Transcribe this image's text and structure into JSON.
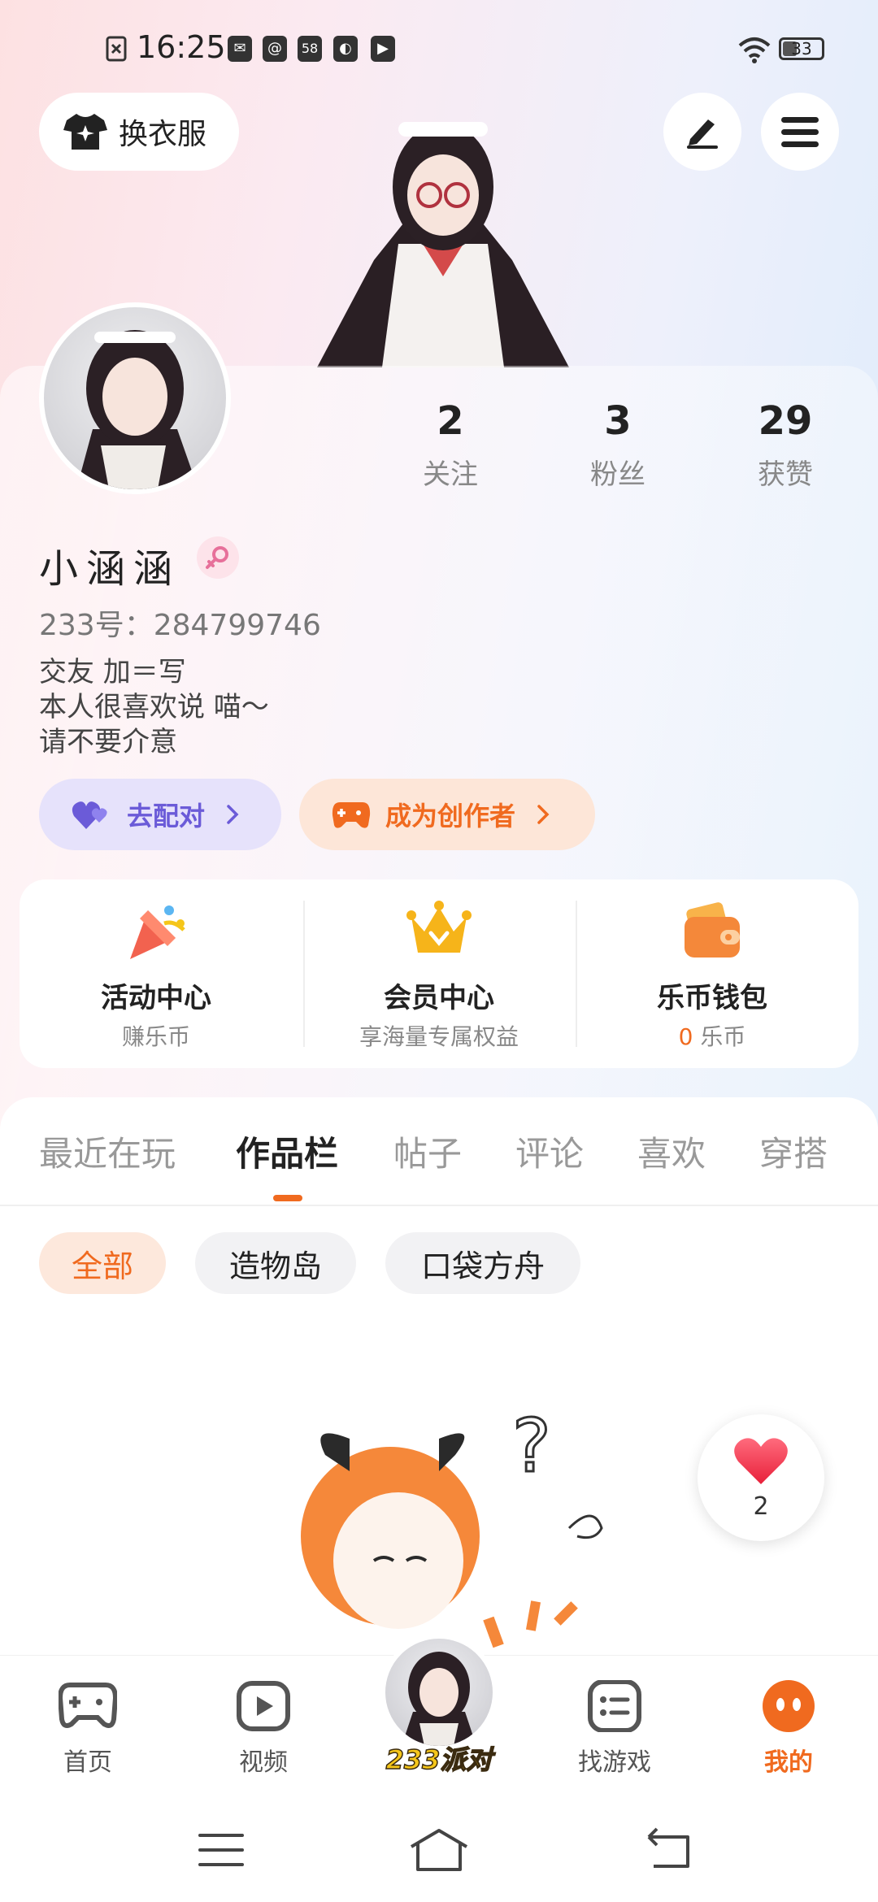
{
  "status_bar": {
    "time": "16:25",
    "notif_58": "58",
    "battery": "33"
  },
  "header": {
    "outfit_label": "换衣服"
  },
  "profile": {
    "username": "小涵涵",
    "uid_text": "233号：284799746",
    "bio": "交友 加＝写\n本人很喜欢说 喵～\n请不要介意",
    "stats": [
      {
        "value": "2",
        "label": "关注"
      },
      {
        "value": "3",
        "label": "粉丝"
      },
      {
        "value": "29",
        "label": "获赞"
      }
    ],
    "match_label": "去配对",
    "creator_label": "成为创作者"
  },
  "quick_actions": [
    {
      "title": "活动中心",
      "subtitle": "赚乐币"
    },
    {
      "title": "会员中心",
      "subtitle": "享海量专属权益"
    },
    {
      "title": "乐币钱包",
      "coin": "0",
      "subtitle_unit": "乐币"
    }
  ],
  "tabs": [
    "最近在玩",
    "作品栏",
    "帖子",
    "评论",
    "喜欢",
    "穿搭"
  ],
  "active_tab": "作品栏",
  "chips": [
    "全部",
    "造物岛",
    "口袋方舟"
  ],
  "like_float": {
    "count": "2"
  },
  "bottom_nav": {
    "items": [
      "首页",
      "视频",
      "找游戏",
      "我的"
    ],
    "center_label": "233派对"
  },
  "colors": {
    "accent": "#f06a1f",
    "match_purple": "#6b5bd8"
  }
}
